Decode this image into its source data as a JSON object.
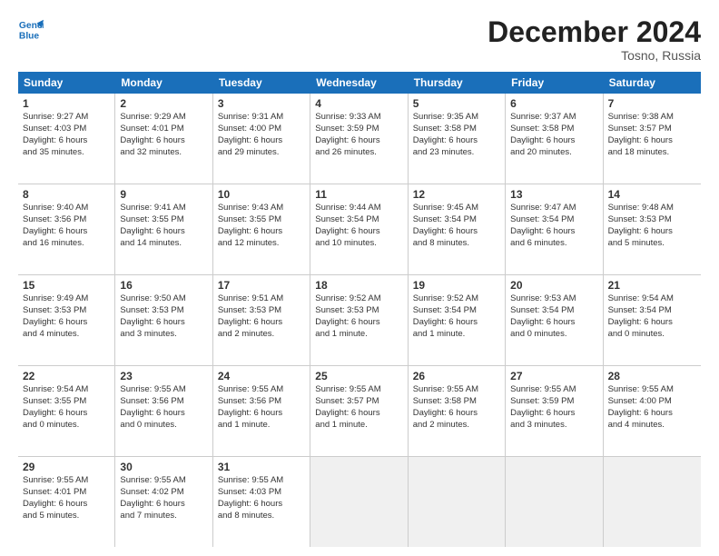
{
  "logo": {
    "line1": "General",
    "line2": "Blue"
  },
  "title": "December 2024",
  "location": "Tosno, Russia",
  "header_days": [
    "Sunday",
    "Monday",
    "Tuesday",
    "Wednesday",
    "Thursday",
    "Friday",
    "Saturday"
  ],
  "rows": [
    [
      {
        "day": "1",
        "lines": [
          "Sunrise: 9:27 AM",
          "Sunset: 4:03 PM",
          "Daylight: 6 hours",
          "and 35 minutes."
        ]
      },
      {
        "day": "2",
        "lines": [
          "Sunrise: 9:29 AM",
          "Sunset: 4:01 PM",
          "Daylight: 6 hours",
          "and 32 minutes."
        ]
      },
      {
        "day": "3",
        "lines": [
          "Sunrise: 9:31 AM",
          "Sunset: 4:00 PM",
          "Daylight: 6 hours",
          "and 29 minutes."
        ]
      },
      {
        "day": "4",
        "lines": [
          "Sunrise: 9:33 AM",
          "Sunset: 3:59 PM",
          "Daylight: 6 hours",
          "and 26 minutes."
        ]
      },
      {
        "day": "5",
        "lines": [
          "Sunrise: 9:35 AM",
          "Sunset: 3:58 PM",
          "Daylight: 6 hours",
          "and 23 minutes."
        ]
      },
      {
        "day": "6",
        "lines": [
          "Sunrise: 9:37 AM",
          "Sunset: 3:58 PM",
          "Daylight: 6 hours",
          "and 20 minutes."
        ]
      },
      {
        "day": "7",
        "lines": [
          "Sunrise: 9:38 AM",
          "Sunset: 3:57 PM",
          "Daylight: 6 hours",
          "and 18 minutes."
        ]
      }
    ],
    [
      {
        "day": "8",
        "lines": [
          "Sunrise: 9:40 AM",
          "Sunset: 3:56 PM",
          "Daylight: 6 hours",
          "and 16 minutes."
        ]
      },
      {
        "day": "9",
        "lines": [
          "Sunrise: 9:41 AM",
          "Sunset: 3:55 PM",
          "Daylight: 6 hours",
          "and 14 minutes."
        ]
      },
      {
        "day": "10",
        "lines": [
          "Sunrise: 9:43 AM",
          "Sunset: 3:55 PM",
          "Daylight: 6 hours",
          "and 12 minutes."
        ]
      },
      {
        "day": "11",
        "lines": [
          "Sunrise: 9:44 AM",
          "Sunset: 3:54 PM",
          "Daylight: 6 hours",
          "and 10 minutes."
        ]
      },
      {
        "day": "12",
        "lines": [
          "Sunrise: 9:45 AM",
          "Sunset: 3:54 PM",
          "Daylight: 6 hours",
          "and 8 minutes."
        ]
      },
      {
        "day": "13",
        "lines": [
          "Sunrise: 9:47 AM",
          "Sunset: 3:54 PM",
          "Daylight: 6 hours",
          "and 6 minutes."
        ]
      },
      {
        "day": "14",
        "lines": [
          "Sunrise: 9:48 AM",
          "Sunset: 3:53 PM",
          "Daylight: 6 hours",
          "and 5 minutes."
        ]
      }
    ],
    [
      {
        "day": "15",
        "lines": [
          "Sunrise: 9:49 AM",
          "Sunset: 3:53 PM",
          "Daylight: 6 hours",
          "and 4 minutes."
        ]
      },
      {
        "day": "16",
        "lines": [
          "Sunrise: 9:50 AM",
          "Sunset: 3:53 PM",
          "Daylight: 6 hours",
          "and 3 minutes."
        ]
      },
      {
        "day": "17",
        "lines": [
          "Sunrise: 9:51 AM",
          "Sunset: 3:53 PM",
          "Daylight: 6 hours",
          "and 2 minutes."
        ]
      },
      {
        "day": "18",
        "lines": [
          "Sunrise: 9:52 AM",
          "Sunset: 3:53 PM",
          "Daylight: 6 hours",
          "and 1 minute."
        ]
      },
      {
        "day": "19",
        "lines": [
          "Sunrise: 9:52 AM",
          "Sunset: 3:54 PM",
          "Daylight: 6 hours",
          "and 1 minute."
        ]
      },
      {
        "day": "20",
        "lines": [
          "Sunrise: 9:53 AM",
          "Sunset: 3:54 PM",
          "Daylight: 6 hours",
          "and 0 minutes."
        ]
      },
      {
        "day": "21",
        "lines": [
          "Sunrise: 9:54 AM",
          "Sunset: 3:54 PM",
          "Daylight: 6 hours",
          "and 0 minutes."
        ]
      }
    ],
    [
      {
        "day": "22",
        "lines": [
          "Sunrise: 9:54 AM",
          "Sunset: 3:55 PM",
          "Daylight: 6 hours",
          "and 0 minutes."
        ]
      },
      {
        "day": "23",
        "lines": [
          "Sunrise: 9:55 AM",
          "Sunset: 3:56 PM",
          "Daylight: 6 hours",
          "and 0 minutes."
        ]
      },
      {
        "day": "24",
        "lines": [
          "Sunrise: 9:55 AM",
          "Sunset: 3:56 PM",
          "Daylight: 6 hours",
          "and 1 minute."
        ]
      },
      {
        "day": "25",
        "lines": [
          "Sunrise: 9:55 AM",
          "Sunset: 3:57 PM",
          "Daylight: 6 hours",
          "and 1 minute."
        ]
      },
      {
        "day": "26",
        "lines": [
          "Sunrise: 9:55 AM",
          "Sunset: 3:58 PM",
          "Daylight: 6 hours",
          "and 2 minutes."
        ]
      },
      {
        "day": "27",
        "lines": [
          "Sunrise: 9:55 AM",
          "Sunset: 3:59 PM",
          "Daylight: 6 hours",
          "and 3 minutes."
        ]
      },
      {
        "day": "28",
        "lines": [
          "Sunrise: 9:55 AM",
          "Sunset: 4:00 PM",
          "Daylight: 6 hours",
          "and 4 minutes."
        ]
      }
    ],
    [
      {
        "day": "29",
        "lines": [
          "Sunrise: 9:55 AM",
          "Sunset: 4:01 PM",
          "Daylight: 6 hours",
          "and 5 minutes."
        ]
      },
      {
        "day": "30",
        "lines": [
          "Sunrise: 9:55 AM",
          "Sunset: 4:02 PM",
          "Daylight: 6 hours",
          "and 7 minutes."
        ]
      },
      {
        "day": "31",
        "lines": [
          "Sunrise: 9:55 AM",
          "Sunset: 4:03 PM",
          "Daylight: 6 hours",
          "and 8 minutes."
        ]
      },
      null,
      null,
      null,
      null
    ]
  ]
}
